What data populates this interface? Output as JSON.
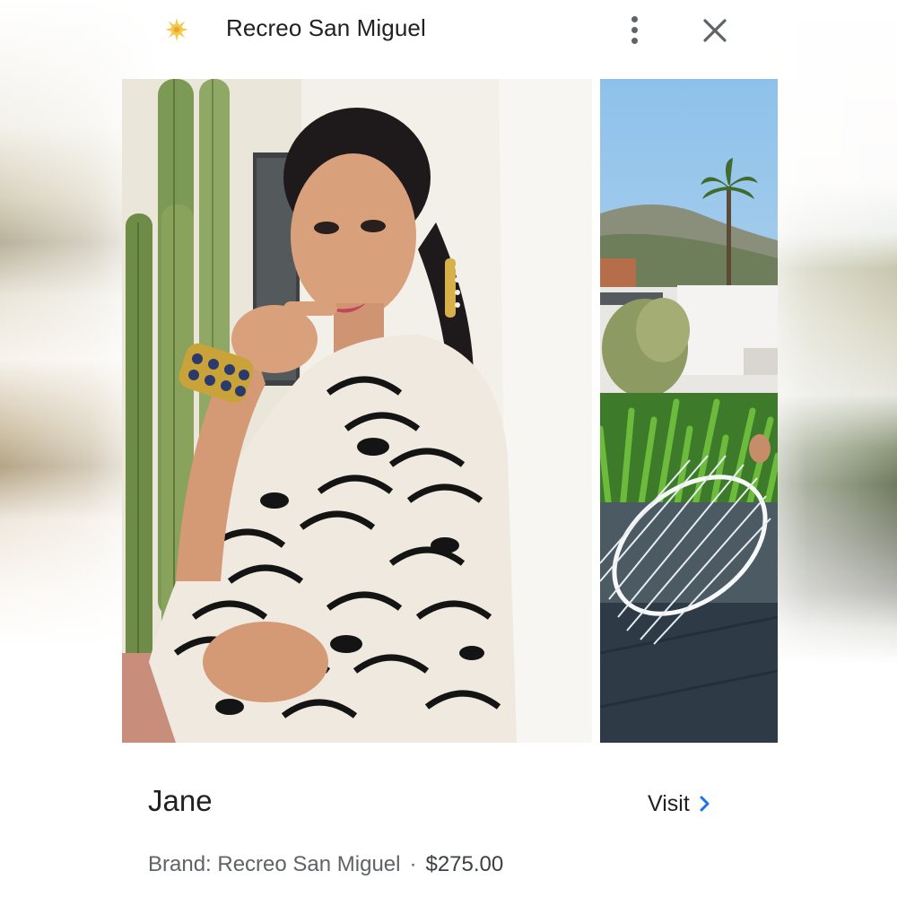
{
  "header": {
    "title": "Recreo San Miguel",
    "logo_icon": "sun-logo-icon",
    "more_icon": "more-vert-icon",
    "close_icon": "close-icon"
  },
  "carousel": {
    "images": [
      {
        "subject": "woman-zebra-print-blouse-with-cactus"
      },
      {
        "subject": "rooftop-with-white-wire-chair-and-palm"
      }
    ]
  },
  "product": {
    "name": "Jane",
    "visit_label": "Visit",
    "brand_label": "Brand: Recreo San Miguel",
    "separator": "·",
    "price": "$275.00"
  },
  "colors": {
    "text_primary": "#202124",
    "text_secondary": "#5f6368",
    "accent_chevron": "#1a73e8",
    "logo": "#f2c94c"
  }
}
